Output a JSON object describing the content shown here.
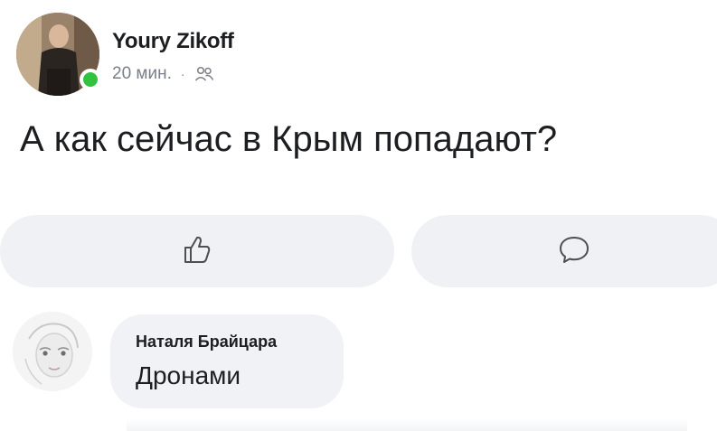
{
  "post": {
    "author_name": "Youry Zikoff",
    "time": "20 мин.",
    "separator": "·",
    "audience_icon": "friends-icon",
    "online_color": "#31c23f",
    "text": "А как сейчас в Крым попадают?"
  },
  "actions": {
    "like_icon": "thumbs-up-icon",
    "comment_icon": "speech-bubble-icon"
  },
  "comment": {
    "author_name": "Наталя Брайцара",
    "text": "Дронами"
  }
}
